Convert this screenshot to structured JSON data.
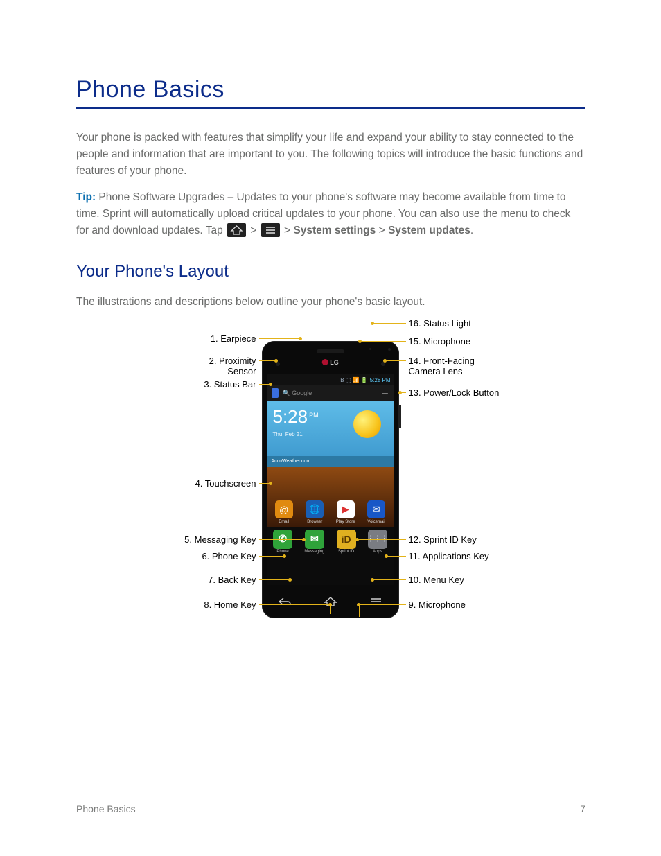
{
  "title": "Phone Basics",
  "rule_color": "#0c2c8a",
  "intro": {
    "heading": "Your Phone's Layout",
    "lead_in": "The illustrations and descriptions below outline your phone's basic layout.",
    "para": "Your phone is packed with features that simplify your life and expand your ability to stay connected to the people and information that are important to you. The following topics will introduce the basic functions and features of your phone.",
    "tip_label": "Tip:",
    "tip_body_a": " Phone Software Upgrades – Updates to your phone's software may become available from time to time. Sprint will automatically upload critical updates to your phone. You can also use the menu to check for and download updates. Tap ",
    "tip_link_a": " > ",
    "tip_link_b": " > ",
    "tip_body_b": "System settings",
    "tip_body_c": " > ",
    "tip_body_d": "System updates"
  },
  "phone_ui": {
    "logo": "LG",
    "status_icons": "B ⬚ 📶 🔋",
    "status_time": "5:28 PM",
    "search_placeholder": "Google",
    "widget_time": "5:28",
    "widget_ampm": "PM",
    "widget_date": "Thu, Feb 21",
    "widget_strip": "AccuWeather.com",
    "apps_row": [
      {
        "label": "Email",
        "bg": "#e08a10",
        "glyph": "@"
      },
      {
        "label": "Browser",
        "bg": "#1a5fb4",
        "glyph": "🌐"
      },
      {
        "label": "Play Store",
        "bg": "#fff",
        "glyph": "▶",
        "fg": "#d33"
      },
      {
        "label": "Voicemail",
        "bg": "#1857c7",
        "glyph": "✉"
      }
    ],
    "dock": [
      {
        "label": "Phone",
        "bg": "#2fa33a",
        "glyph": "✆"
      },
      {
        "label": "Messaging",
        "bg": "#2fa33a",
        "glyph": "✉"
      },
      {
        "label": "Sprint ID",
        "bg": "#e0b020",
        "glyph": "iD",
        "fg": "#5b3b00"
      },
      {
        "label": "Apps",
        "bg": "#7a7c82",
        "glyph": "⋮⋮⋮"
      }
    ]
  },
  "callouts": {
    "left": [
      {
        "n": "1",
        "label": "Earpiece"
      },
      {
        "n": "2",
        "label": "Proximity\nSensor"
      },
      {
        "n": "3",
        "label": "Status Bar"
      },
      {
        "n": "4",
        "label": "Touchscreen"
      },
      {
        "n": "5",
        "label": "Messaging Key"
      },
      {
        "n": "6",
        "label": "Phone Key"
      },
      {
        "n": "7",
        "label": "Back Key"
      },
      {
        "n": "8",
        "label": "Home Key"
      }
    ],
    "right": [
      {
        "n": "16",
        "label": "Status Light"
      },
      {
        "n": "15",
        "label": "Microphone"
      },
      {
        "n": "14",
        "label": "Front-Facing\nCamera Lens"
      },
      {
        "n": "13",
        "label": "Power/Lock Button"
      },
      {
        "n": "12",
        "label": "Sprint ID Key"
      },
      {
        "n": "11",
        "label": "Applications Key"
      },
      {
        "n": "10",
        "label": "Menu Key"
      },
      {
        "n": "9",
        "label": "Microphone"
      }
    ]
  },
  "footer": {
    "section": "Phone Basics",
    "page": "7"
  }
}
